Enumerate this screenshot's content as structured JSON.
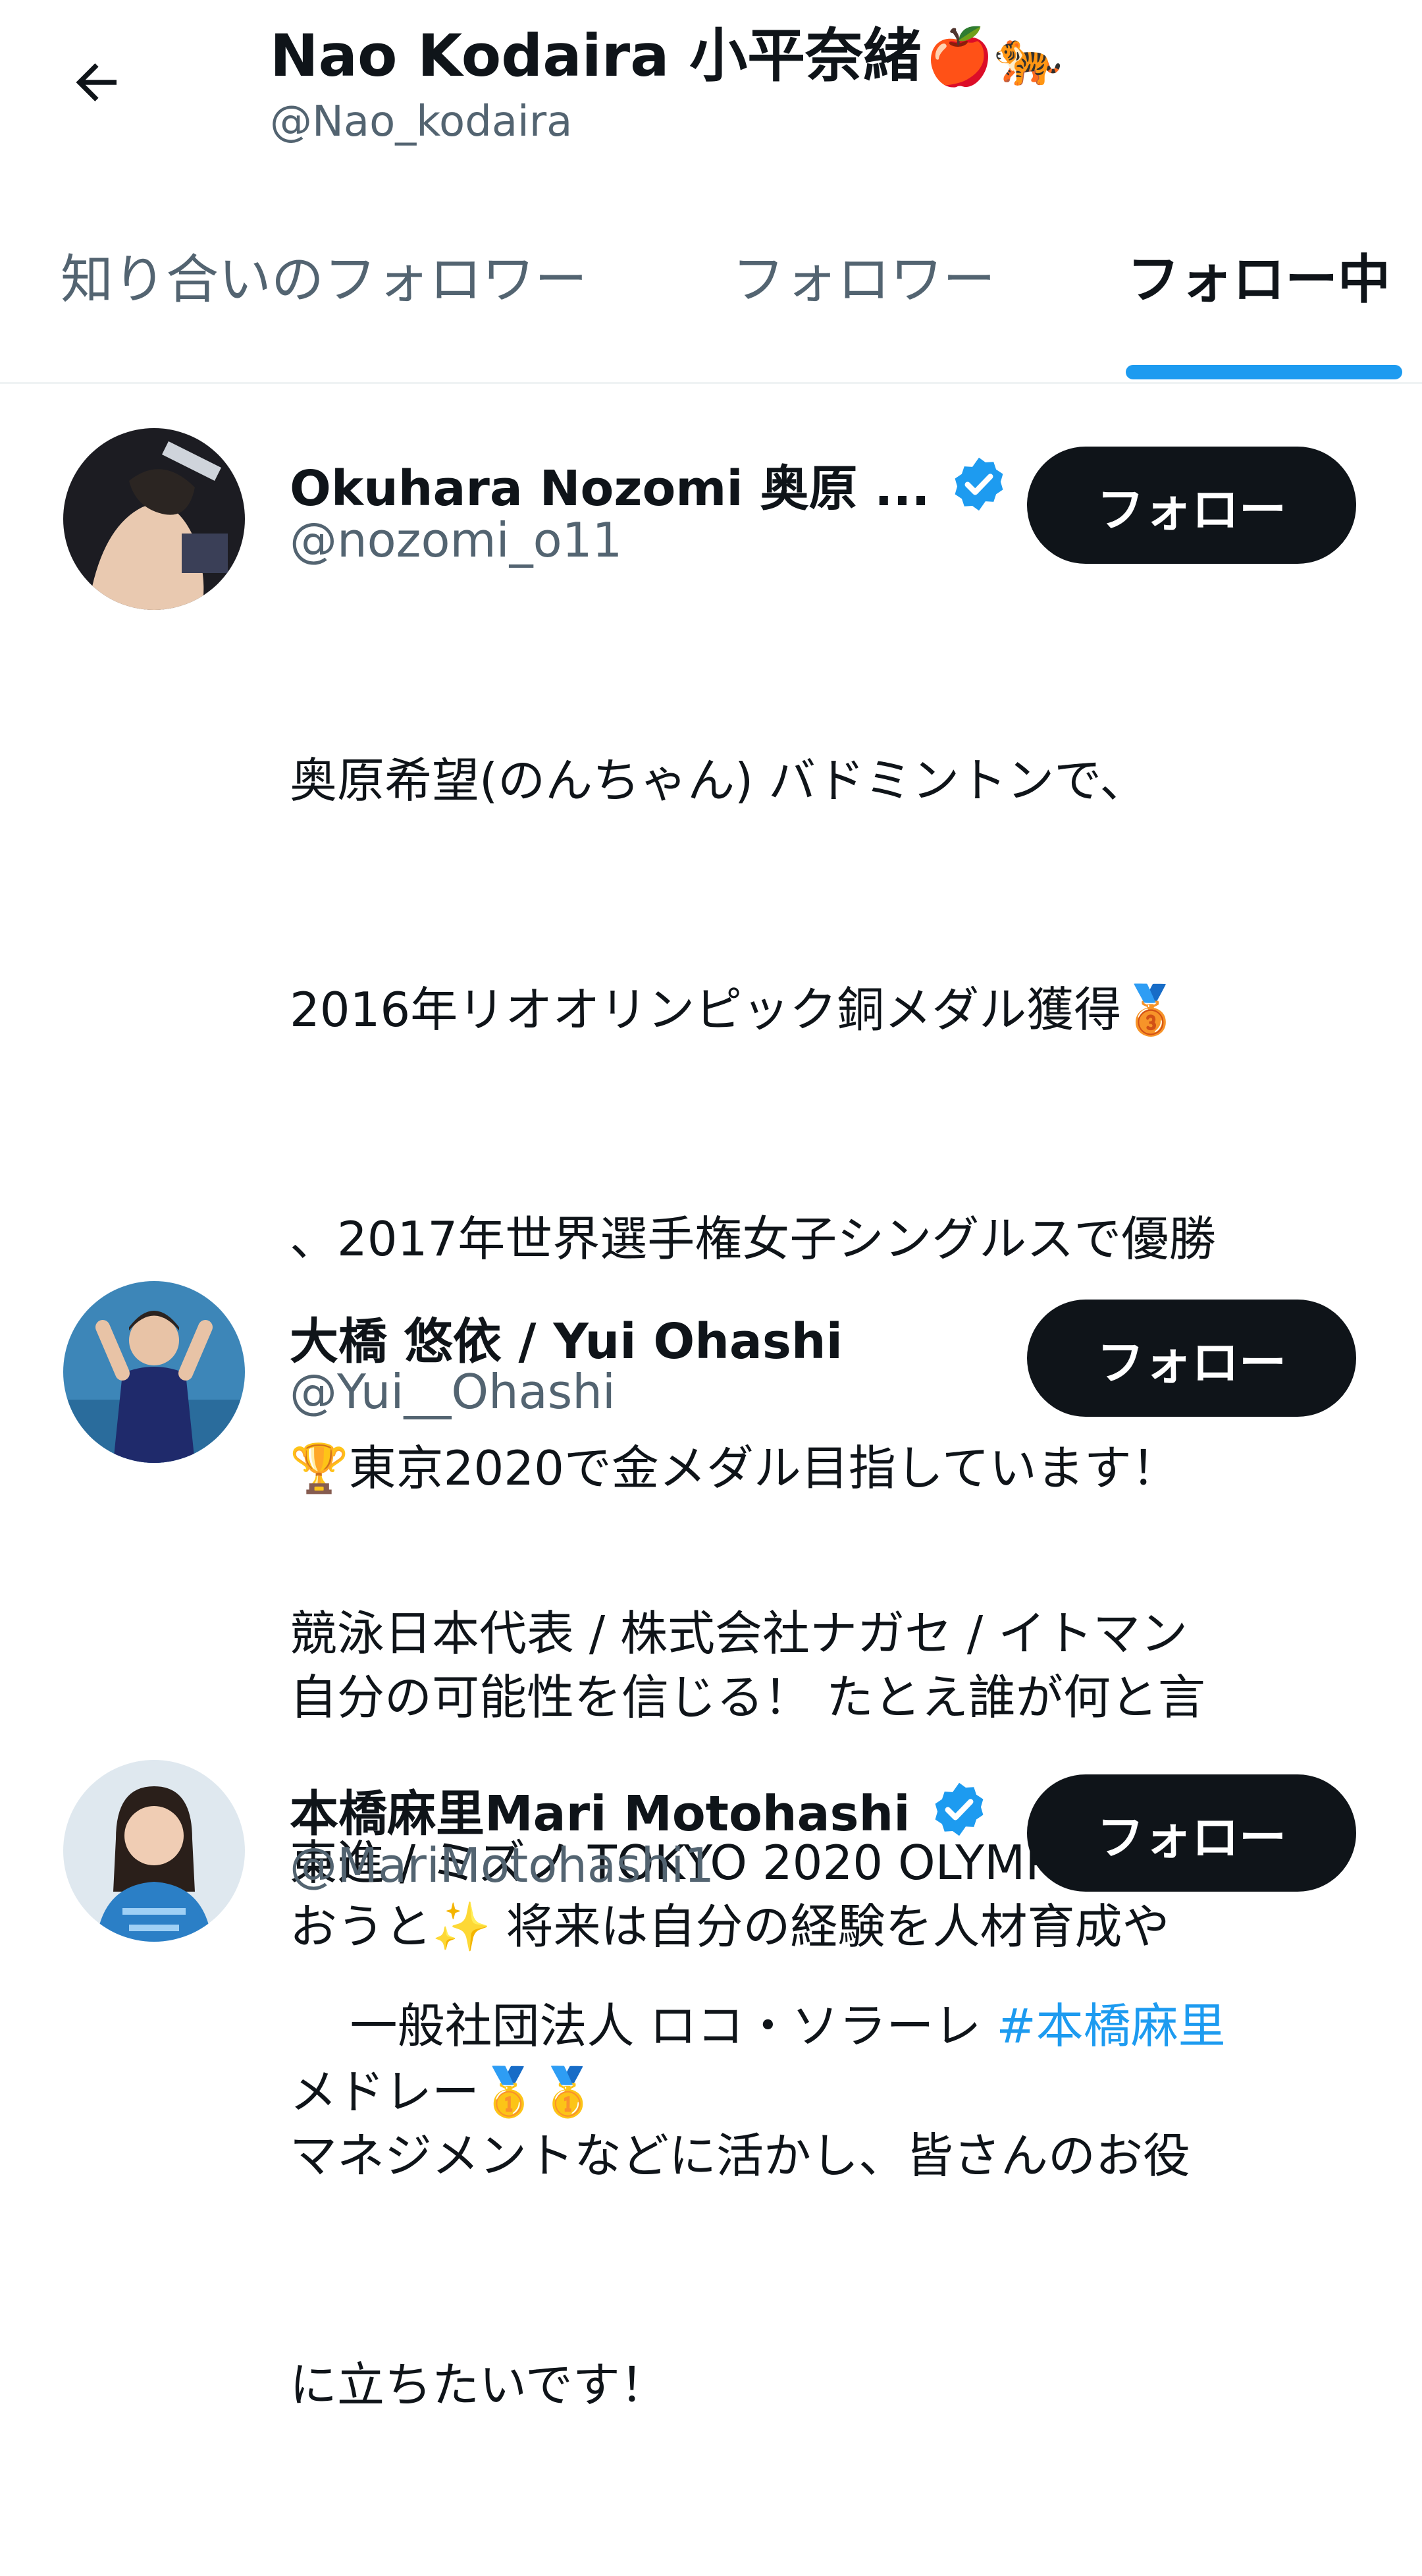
{
  "header": {
    "title": "Nao Kodaira 小平奈緒",
    "title_emoji": "🍎🐅",
    "handle": "@Nao_kodaira"
  },
  "tabs": [
    {
      "label": "知り合いのフォロワー",
      "active": false
    },
    {
      "label": "フォロワー",
      "active": false
    },
    {
      "label": "フォロー中",
      "active": true
    }
  ],
  "users": [
    {
      "name": "Okuhara Nozomi 奥原 ...",
      "handle": "@nozomi_o11",
      "verified": true,
      "button": "フォロー",
      "bio_lines": [
        "奥原希望(のんちゃん) バドミントンで、",
        "2016年リオオリンピック銅メダル獲得🥉",
        "、2017年世界選手権女子シングルスで優勝",
        "🏆東京2020で金メダル目指しています！",
        "自分の可能性を信じる！ たとえ誰が何と言",
        "おうと✨ 将来は自分の経験を人材育成や",
        "マネジメントなどに活かし、皆さんのお役",
        "に立ちたいです！"
      ]
    },
    {
      "name": "大橋 悠依 / Yui Ohashi",
      "handle": "@Yui__Ohashi",
      "verified": false,
      "button": "フォロー",
      "bio_lines": [
        "競泳日本代表 / 株式会社ナガセ / イトマン",
        "東進 / ミズノ TOKYO 2020 OLYMPIC 個人",
        "メドレー🥇🥇"
      ]
    },
    {
      "name": "本橋麻里Mari Motohashi",
      "handle": "@MariMotohashi1",
      "verified": true,
      "button": "フォロー",
      "bio_prefix": "一般社団法人 ロコ・ソラーレ ",
      "bio_hashtag": "#本橋麻里"
    }
  ],
  "colors": {
    "accent": "#1d9bf0",
    "text_primary": "#0f1419",
    "text_secondary": "#536471",
    "button_bg": "#0f1419"
  },
  "icons": {
    "back": "arrow-left-icon",
    "verified": "verified-badge-icon"
  }
}
